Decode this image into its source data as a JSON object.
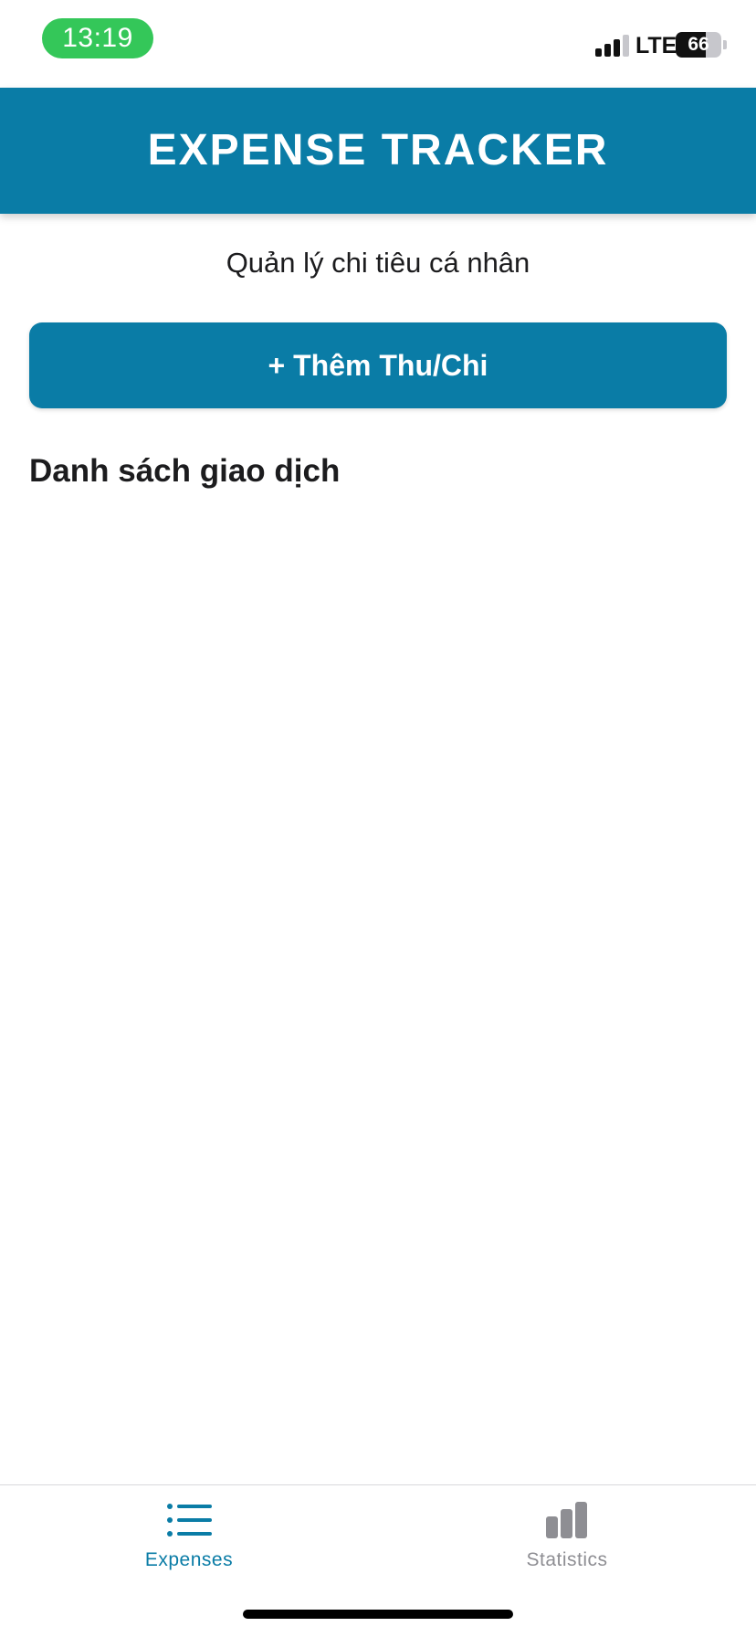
{
  "status_bar": {
    "time": "13:19",
    "network": "LTE",
    "battery_level": "66",
    "battery_fraction": 0.66,
    "signal_bars_active": 3,
    "time_pill_color": "#34c759"
  },
  "header": {
    "title": "EXPENSE TRACKER",
    "background_color": "#0a7ca6"
  },
  "main": {
    "subtitle": "Quản lý chi tiêu cá nhân",
    "add_button_label": "+ Thêm Thu/Chi",
    "section_title": "Danh sách giao dịch",
    "transactions": []
  },
  "tab_bar": {
    "tabs": [
      {
        "label": "Expenses",
        "icon": "list-icon",
        "active": true
      },
      {
        "label": "Statistics",
        "icon": "bar-chart-icon",
        "active": false
      }
    ],
    "active_color": "#0a7ca6",
    "inactive_color": "#8e8e93"
  }
}
